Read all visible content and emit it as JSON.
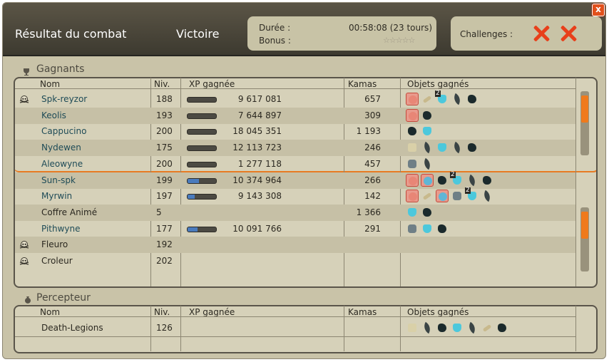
{
  "window": {
    "title": "Résultat du combat",
    "outcome": "Victoire",
    "close_label": "x",
    "duration_label": "Durée :",
    "duration_value": "00:58:08 (23 tours)",
    "bonus_label": "Bonus :",
    "bonus_stars": "☆☆☆☆☆",
    "challenges_label": "Challenges :"
  },
  "columns": {
    "name": "Nom",
    "level": "Niv.",
    "xp": "XP gagnée",
    "kamas": "Kamas",
    "items": "Objets gagnés"
  },
  "winners": {
    "title": "Gagnants",
    "rows": [
      {
        "name": "Spk-reyzor",
        "level": "188",
        "xp": "9 617 081",
        "kamas": "657",
        "skull": true,
        "bar": 0.0,
        "items": [
          "paw:sel",
          "bone",
          "potion:2",
          "feather",
          "boot"
        ]
      },
      {
        "name": "Keolis",
        "level": "193",
        "xp": "7 644 897",
        "kamas": "309",
        "skull": false,
        "bar": 0.0,
        "items": [
          "paw:sel",
          "boot"
        ]
      },
      {
        "name": "Cappucino",
        "level": "200",
        "xp": "18 045 351",
        "kamas": "1 193",
        "skull": false,
        "bar": 0.0,
        "items": [
          "boot",
          "potion"
        ]
      },
      {
        "name": "Nydewen",
        "level": "175",
        "xp": "12 113 723",
        "kamas": "246",
        "skull": false,
        "bar": 0.0,
        "items": [
          "cloth",
          "feather",
          "potion",
          "feather",
          "boot"
        ]
      },
      {
        "name": "Aleowyne",
        "level": "200",
        "xp": "1 277 118",
        "kamas": "457",
        "skull": false,
        "bar": 0.0,
        "items": [
          "stone",
          "feather"
        ]
      },
      {
        "name": "Sun-spk",
        "level": "199",
        "xp": "10 374 964",
        "kamas": "266",
        "skull": false,
        "bar": 0.4,
        "items": [
          "paw:sel",
          "pet:sel",
          "boot",
          "potion:2",
          "feather",
          "boot"
        ]
      },
      {
        "name": "Myrwin",
        "level": "197",
        "xp": "9 143 308",
        "kamas": "142",
        "skull": false,
        "bar": 0.25,
        "items": [
          "paw:sel",
          "bone",
          "pet:sel",
          "stone",
          "potion:2",
          "feather"
        ]
      },
      {
        "name": "Coffre Animé",
        "level": "5",
        "xp": "",
        "kamas": "1 366",
        "skull": false,
        "bar": null,
        "items": [
          "potion",
          "boot"
        ]
      },
      {
        "name": "Pithwyne",
        "level": "177",
        "xp": "10 091 766",
        "kamas": "291",
        "skull": false,
        "bar": 0.35,
        "items": [
          "stone",
          "potion",
          "boot"
        ]
      },
      {
        "name": "Fleuro",
        "level": "192",
        "xp": "",
        "kamas": "",
        "skull": true,
        "bar": null,
        "items": []
      },
      {
        "name": "Croleur",
        "level": "202",
        "xp": "",
        "kamas": "",
        "skull": true,
        "bar": null,
        "items": []
      }
    ]
  },
  "collector": {
    "title": "Percepteur",
    "rows": [
      {
        "name": "Death-Legions",
        "level": "126",
        "xp": "",
        "kamas": "",
        "items": [
          "cloth",
          "feather",
          "boot",
          "potion",
          "feather",
          "bone",
          "boot"
        ]
      }
    ]
  },
  "colors": {
    "accent": "#e77b23",
    "header": "#3d3a30",
    "panel": "#d6d1b9",
    "name_link": "#1e4b57",
    "challenge_fail": "#e83f1a"
  }
}
